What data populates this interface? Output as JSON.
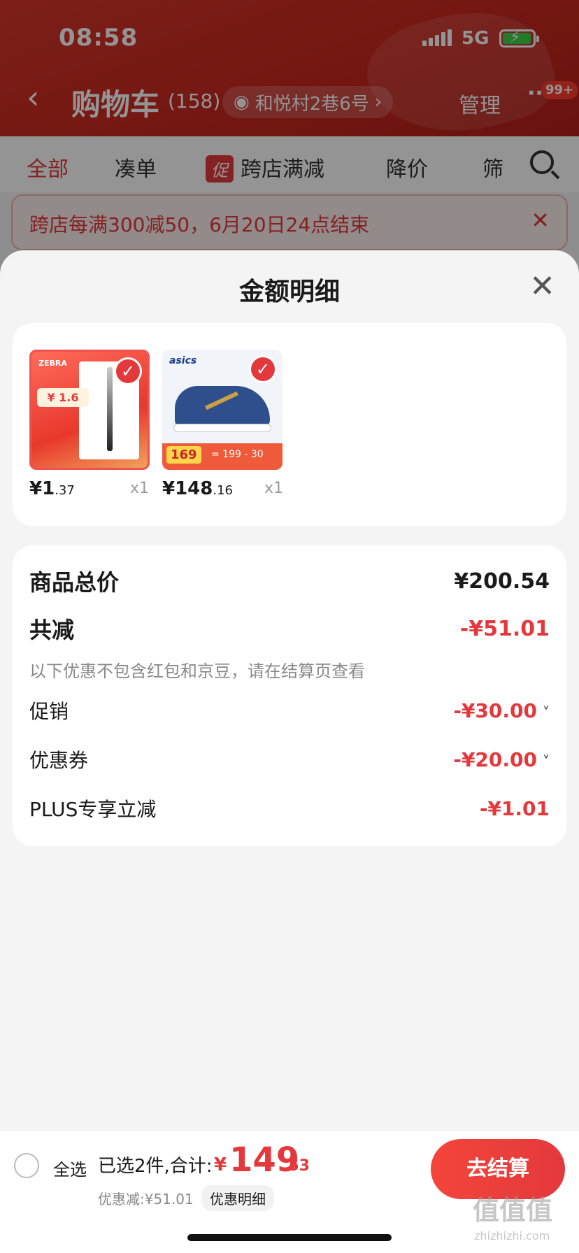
{
  "status": {
    "time": "08:58",
    "network": "5G"
  },
  "nav": {
    "back": "‹",
    "title": "购物车",
    "count": "(158)",
    "address": "和悦村2巷6号",
    "address_arrow": "›",
    "manage": "管理",
    "more": "···",
    "badge": "99+"
  },
  "tabs": [
    {
      "label": "全部"
    },
    {
      "label": "凑单"
    },
    {
      "label": "跨店满减",
      "tag": "促"
    },
    {
      "label": "降价"
    },
    {
      "label": "筛"
    }
  ],
  "banner": {
    "text": "跨店每满300减50，6月20日24点结束",
    "close": "✕"
  },
  "sheet": {
    "title": "金额明细",
    "close": "✕"
  },
  "items": [
    {
      "price_int": "¥1",
      "price_dec": ".37",
      "qty": "x1",
      "brand": "ZEBRA",
      "promo": "¥ 1.6"
    },
    {
      "price_int": "¥148",
      "price_dec": ".16",
      "qty": "x1",
      "brand": "asics",
      "promo": "169",
      "promo_eq": "= 199 - 30"
    }
  ],
  "summary": {
    "total_label": "商品总价",
    "total_value": "¥200.54",
    "reduce_label": "共减",
    "reduce_value": "-¥51.01",
    "note": "以下优惠不包含红包和京豆，请在结算页查看",
    "promo_label": "促销",
    "promo_value": "-¥30.00",
    "coupon_label": "优惠券",
    "coupon_value": "-¥20.00",
    "plus_label": "PLUS专享立减",
    "plus_value": "-¥1.01",
    "chevron": "˅"
  },
  "bottom": {
    "select_all": "全选",
    "selected_text": "已选2件,合计:",
    "total_currency": "¥",
    "total_int": "149",
    "total_dec": ".53",
    "discount": "优惠减:¥51.01",
    "detail": "优惠明细",
    "checkout": "去结算"
  },
  "watermark": {
    "text": "值值值",
    "sub": "zhizhizhi.com"
  },
  "colors": {
    "accent": "#e4393c",
    "header": "#d8362c"
  }
}
